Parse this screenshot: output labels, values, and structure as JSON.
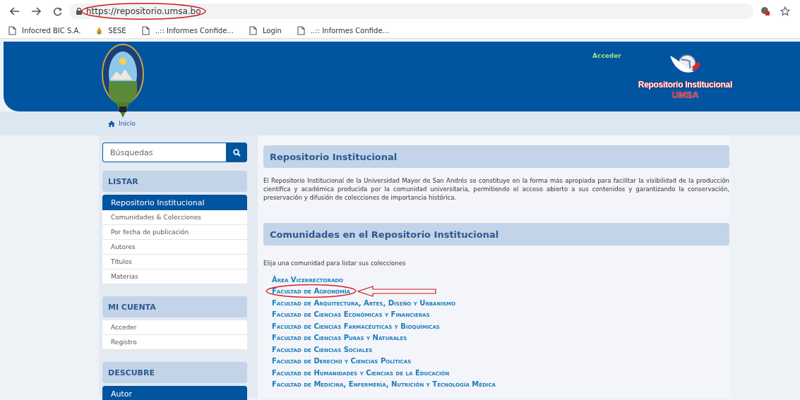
{
  "browser": {
    "url": "https://repositorio.umsa.bo",
    "url_highlighted": true,
    "bookmarks": [
      {
        "label": "Infocred BIC S.A.",
        "kind": "page"
      },
      {
        "label": "SESE",
        "kind": "flame"
      },
      {
        "label": "..:: Informes Confide...",
        "kind": "page"
      },
      {
        "label": "Login",
        "kind": "page"
      },
      {
        "label": "..:: Informes Confide...",
        "kind": "page"
      }
    ]
  },
  "header": {
    "login_link": "Acceder",
    "logo_title": "Repositorio Institucional",
    "logo_subtitle": "UMSA"
  },
  "breadcrumb": [
    {
      "label": "Inicio"
    }
  ],
  "sidebar": {
    "search": {
      "placeholder": "Búsquedas"
    },
    "sections": [
      {
        "title": "LISTAR",
        "items": [
          {
            "label": "Repositorio Institucional",
            "kind": "heading"
          },
          {
            "label": "Comunidades & Colecciones",
            "kind": "link"
          },
          {
            "label": "Por fecha de publicación",
            "kind": "link"
          },
          {
            "label": "Autores",
            "kind": "link"
          },
          {
            "label": "Títulos",
            "kind": "link"
          },
          {
            "label": "Materias",
            "kind": "link"
          }
        ]
      },
      {
        "title": "MI CUENTA",
        "items": [
          {
            "label": "Acceder",
            "kind": "link"
          },
          {
            "label": "Registro",
            "kind": "link"
          }
        ]
      },
      {
        "title": "DESCUBRE",
        "items": [
          {
            "label": "Autor",
            "kind": "heading"
          }
        ]
      }
    ]
  },
  "main": {
    "intro_title": "Repositorio Institucional",
    "intro_text": "El Repositorio Institucional de la Universidad Mayor de San Andrés se constituye en la forma más apropiada para facilitar la visibilidad de la producción científica y académica producida por la comunidad universitaria, permitiendo el acceso abierto a sus contenidos y garantizando la conservación, preservación y difusión de colecciones de importancia histórica.",
    "communities_title": "Comunidades en el Repositorio Institucional",
    "communities_hint": "Elija una comunidad para listar sus colecciones",
    "communities": [
      {
        "label": "Área Vicerrectorado",
        "highlighted": false
      },
      {
        "label": "Facultad de Agronomía",
        "highlighted": true
      },
      {
        "label": "Facultad de Arquitectura, Artes, Diseño y Urbanismo",
        "highlighted": false
      },
      {
        "label": "Facultad de Ciencias Económicas y Financieras",
        "highlighted": false
      },
      {
        "label": "Facultad de Ciencias Farmacéuticas y Bioquímicas",
        "highlighted": false
      },
      {
        "label": "Facultad de Ciencias Puras y Naturales",
        "highlighted": false
      },
      {
        "label": "Facultad de Ciencias Sociales",
        "highlighted": false
      },
      {
        "label": "Facultad de Derecho y Ciencias Políticas",
        "highlighted": false
      },
      {
        "label": "Facultad de Humanidades y Ciencias de la Educación",
        "highlighted": false
      },
      {
        "label": "Facultad de Medicina, Enfermería, Nutrición y Tecnología Médica",
        "highlighted": false
      }
    ]
  }
}
